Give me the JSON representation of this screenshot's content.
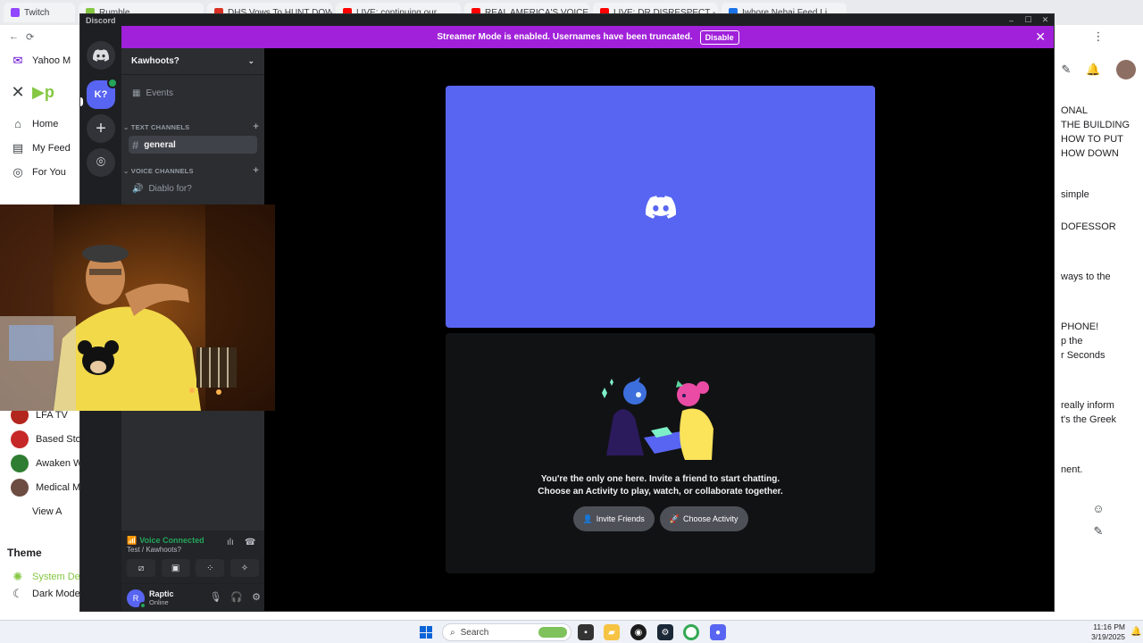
{
  "browser": {
    "tabs": [
      {
        "label": "Twitch",
        "color": "#9146ff"
      },
      {
        "label": "Rumble",
        "color": "#85c742"
      },
      {
        "label": "DHS Vows To HUNT DOWN L",
        "color": "#d93025"
      },
      {
        "label": "LIVE: continuing our",
        "color": "#ff0000"
      },
      {
        "label": "REAL AMERICA'S VOICE",
        "color": "#ff0000"
      },
      {
        "label": "LIVE: DR DISRESPECT - W",
        "color": "#ff0000"
      },
      {
        "label": "Iwhore Nehai Feed Li",
        "color": "#1a73e8"
      }
    ],
    "left_nav": [
      {
        "label": "Yahoo M",
        "icon": "yahoo-icon"
      },
      {
        "label": "Home",
        "icon": "home-icon"
      },
      {
        "label": "My Feed",
        "icon": "feed-icon"
      },
      {
        "label": "For You",
        "icon": "compass-icon"
      }
    ],
    "left_channels": [
      {
        "label": "LFA TV",
        "color": "#b3261e"
      },
      {
        "label": "Based Stor",
        "color": "#c62828"
      },
      {
        "label": "Awaken Wi",
        "color": "#2e7d32"
      },
      {
        "label": "Medical M",
        "color": "#6d4c41"
      },
      {
        "label": "View A",
        "color": "#ffffff"
      }
    ],
    "theme": {
      "heading": "Theme",
      "option1": "System De",
      "option2": "Dark Mode"
    },
    "right_snippets": [
      "ONAL",
      "THE BUILDING",
      "HOW TO PUT",
      "HOW DOWN",
      "simple",
      "DOFESSOR",
      "ways to the",
      "PHONE!",
      "p the",
      "r Seconds",
      "really inform",
      "t's the Greek",
      "nent."
    ]
  },
  "discord": {
    "title": "Discord",
    "window_controls": {
      "minimize": "–",
      "maximize": "☐",
      "close": "✕"
    },
    "banner": {
      "text": "Streamer Mode is enabled. Usernames have been truncated.",
      "button": "Disable",
      "close": "✕"
    },
    "guilds": {
      "active_label": "K?"
    },
    "server": {
      "name": "Kawhoots?"
    },
    "events": "Events",
    "text_category": "TEXT CHANNELS",
    "text_channel": "general",
    "voice_category": "VOICE CHANNELS",
    "voice_channel": "Diablo for?",
    "voice_status": {
      "title": "Voice Connected",
      "subtitle": "Test / Kawhoots?"
    },
    "user": {
      "name": "Raptic",
      "status": "Online",
      "initial": "R"
    },
    "activity": {
      "line1": "You're the only one here. Invite a friend to start chatting.",
      "line2": "Choose an Activity to play, watch, or collaborate together.",
      "invite_label": "Invite Friends",
      "activity_label": "Choose Activity"
    }
  },
  "taskbar": {
    "search_placeholder": "Search",
    "time": "11:16 PM",
    "date": "3/19/2025"
  },
  "colors": {
    "blurple": "#5865f2",
    "streamer_purple": "#a021d9",
    "online_green": "#23a55a"
  }
}
